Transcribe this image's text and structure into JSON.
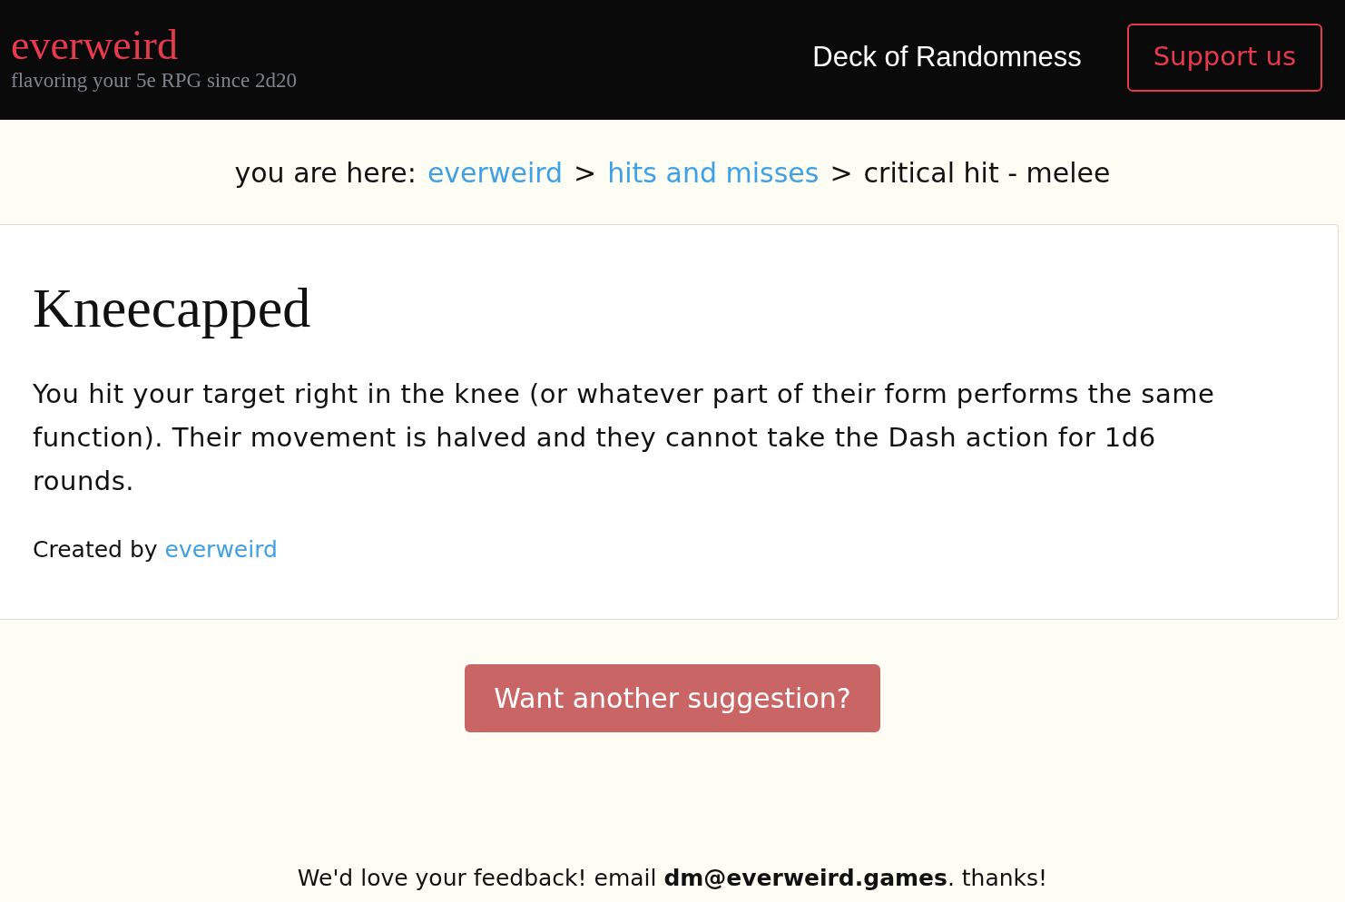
{
  "header": {
    "logo": "everweird",
    "tagline": "flavoring your 5e RPG since 2d20",
    "nav_link": "Deck of Randomness",
    "support_button": "Support us"
  },
  "breadcrumb": [
    {
      "kind": "label",
      "text": "you are here:"
    },
    {
      "kind": "link",
      "text": "everweird"
    },
    {
      "kind": "separator",
      "text": ">"
    },
    {
      "kind": "link",
      "text": "hits and misses"
    },
    {
      "kind": "separator",
      "text": ">"
    },
    {
      "kind": "current",
      "text": "critical hit - melee"
    }
  ],
  "card": {
    "title": "Kneecapped",
    "body": "You hit your target right in the knee (or whatever part of their form performs the same function). Their movement is halved and they cannot take the Dash action for 1d6 rounds.",
    "credit_label": "Created by",
    "credit_link": "everweird"
  },
  "suggestion_button": "Want another suggestion?",
  "footer": "We'd love your feedback! email **dm@everweird.games**. thanks!"
}
